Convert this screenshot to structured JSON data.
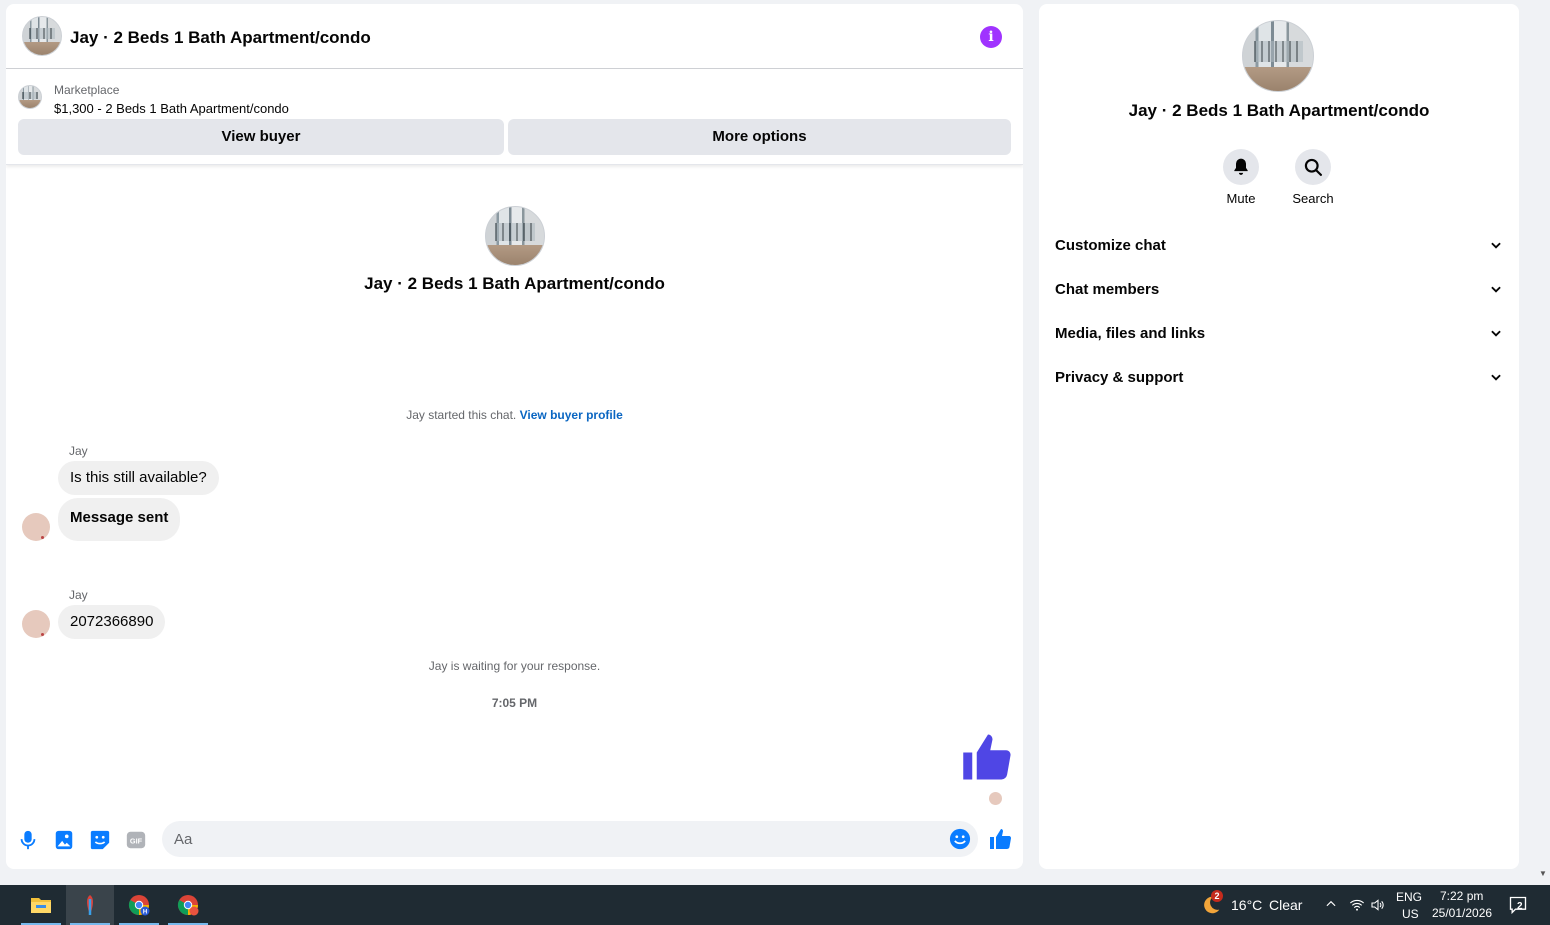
{
  "chat": {
    "header_title": "Jay · 2 Beds 1 Bath Apartment/condo",
    "marketplace_label": "Marketplace",
    "listing": "$1,300 - 2 Beds 1 Bath Apartment/condo",
    "view_buyer": "View buyer",
    "more_options": "More options",
    "convo_title": "Jay · 2 Beds 1 Bath Apartment/condo",
    "started_text": "Jay started this chat.",
    "view_buyer_profile": "View buyer profile",
    "messages": [
      {
        "sender": "Jay",
        "text": "Is this still available?"
      },
      {
        "sender": "",
        "text": "Message sent"
      },
      {
        "sender": "Jay",
        "text": "2072366890"
      }
    ],
    "waiting_text": "Jay is waiting for your response.",
    "timestamp": "7:05 PM",
    "input_placeholder": "Aa"
  },
  "info": {
    "title": "Jay · 2 Beds 1 Bath Apartment/condo",
    "actions": [
      {
        "label": "Mute",
        "icon": "bell-icon"
      },
      {
        "label": "Search",
        "icon": "search-icon"
      }
    ],
    "sections": [
      "Customize chat",
      "Chat members",
      "Media, files and links",
      "Privacy & support"
    ]
  },
  "colors": {
    "accent": "#0a7cff",
    "like": "#4f46e5",
    "info": "#a033ff"
  },
  "taskbar": {
    "weather_badge": "2",
    "temperature": "16°C",
    "condition": "Clear",
    "lang_1": "ENG",
    "lang_2": "US",
    "time": "7:22 pm",
    "date": "25/01/2026",
    "notification_count": "2"
  }
}
